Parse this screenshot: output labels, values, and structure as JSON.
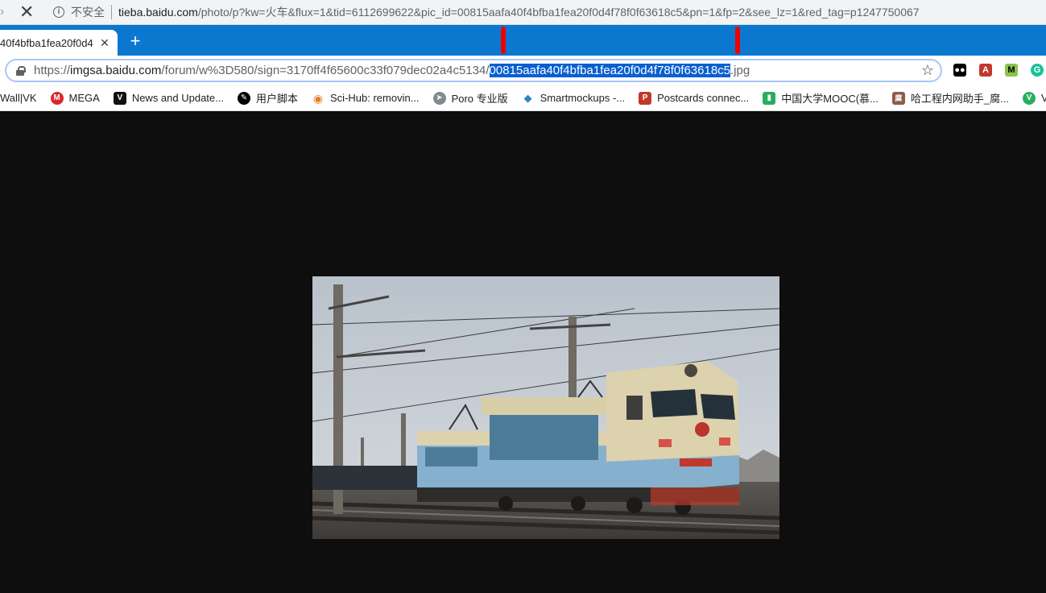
{
  "back_window": {
    "insecure_label": "不安全",
    "url_host": "tieba.baidu.com",
    "url_rest": "/photo/p?kw=火车&flux=1&tid=6112699622&pic_id=00815aafa40f4bfba1fea20f0d4f78f0f63618c5&pn=1&fp=2&see_lz=1&red_tag=p1247750067"
  },
  "tab": {
    "title": "40f4bfba1fea20f0d4",
    "close_glyph": "✕",
    "new_tab_glyph": "+"
  },
  "omnibox": {
    "scheme": "https://",
    "host": "imgsa.baidu.com",
    "path_before": "/forum/w%3D580/sign=3170ff4f65600c33f079dec02a4c5134/",
    "selected": "00815aafa40f4bfba1fea20f0d4f78f0f63618c5",
    "path_after": ".jpg",
    "star_glyph": "☆"
  },
  "extensions": [
    {
      "name": "tampermonkey-icon",
      "color": "#000000",
      "glyph": "●●"
    },
    {
      "name": "acrobat-icon",
      "color": "#c0392b",
      "glyph": "A"
    },
    {
      "name": "m-extension-icon",
      "color": "#8bc34a",
      "glyph": "M"
    },
    {
      "name": "grammarly-icon",
      "color": "#15c39a",
      "glyph": "G"
    }
  ],
  "bookmarks": [
    {
      "label": "Wall|VK",
      "icon": "none",
      "color": ""
    },
    {
      "label": "MEGA",
      "icon": "mega-icon",
      "color": "#d9272e",
      "glyph": "M"
    },
    {
      "label": "News and Update...",
      "icon": "v-icon",
      "color": "#111111",
      "glyph": "V"
    },
    {
      "label": "用户脚本",
      "icon": "userscript-icon",
      "color": "#000000",
      "glyph": "✎"
    },
    {
      "label": "Sci-Hub: removin...",
      "icon": "scihub-icon",
      "color": "#e67e22",
      "glyph": "◉"
    },
    {
      "label": "Poro 专业版",
      "icon": "poro-icon",
      "color": "#7f8c8d",
      "glyph": "➤"
    },
    {
      "label": "Smartmockups -...",
      "icon": "smartmockups-icon",
      "color": "#2c86c9",
      "glyph": "◆"
    },
    {
      "label": "Postcards connec...",
      "icon": "postcrossing-icon",
      "color": "#c0392b",
      "glyph": "P"
    },
    {
      "label": "中国大学MOOC(慕...",
      "icon": "mooc-icon",
      "color": "#27ae60",
      "glyph": "▮"
    },
    {
      "label": "哈工程内网助手_腐...",
      "icon": "fu-icon",
      "color": "#8e5a4a",
      "glyph": "腐"
    },
    {
      "label": "VO",
      "icon": "vo-icon",
      "color": "#27ae60",
      "glyph": "V"
    }
  ]
}
